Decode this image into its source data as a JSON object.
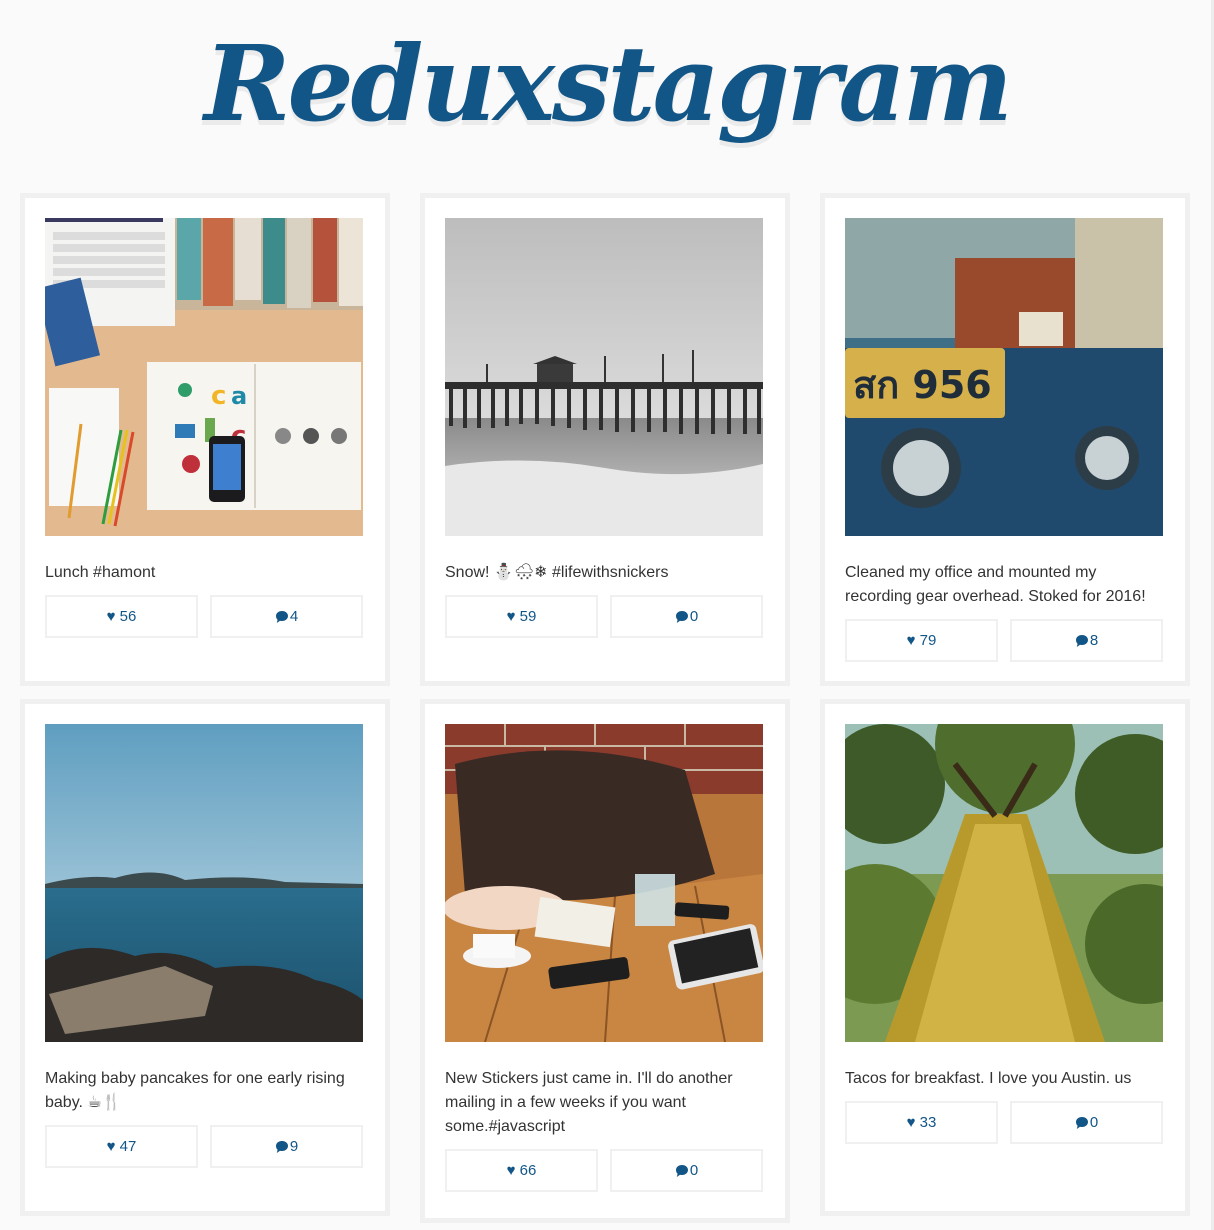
{
  "app": {
    "title": "Reduxstagram"
  },
  "colors": {
    "brand": "#125688",
    "card_border": "#f0f0f0",
    "background": "#fafafa"
  },
  "icons": {
    "like": "heart-icon",
    "comment": "speech-bubble-icon"
  },
  "posts": [
    {
      "caption": "Lunch #hamont",
      "likes": "♥ 56",
      "comments": "4"
    },
    {
      "caption": "Snow! ⛄🌨❄ #lifewithsnickers",
      "likes": "♥ 59",
      "comments": "0"
    },
    {
      "caption": "Cleaned my office and mounted my recording gear overhead. Stoked for 2016!",
      "likes": "♥ 79",
      "comments": "8"
    },
    {
      "caption": "Making baby pancakes for one early rising baby. ☕🍴",
      "likes": "♥ 47",
      "comments": "9"
    },
    {
      "caption": "New Stickers just came in. I'll do another mailing in a few weeks if you want some.#javascript",
      "likes": "♥ 66",
      "comments": "0"
    },
    {
      "caption": "Tacos for breakfast. I love you Austin. us",
      "likes": "♥ 33",
      "comments": "0"
    }
  ]
}
